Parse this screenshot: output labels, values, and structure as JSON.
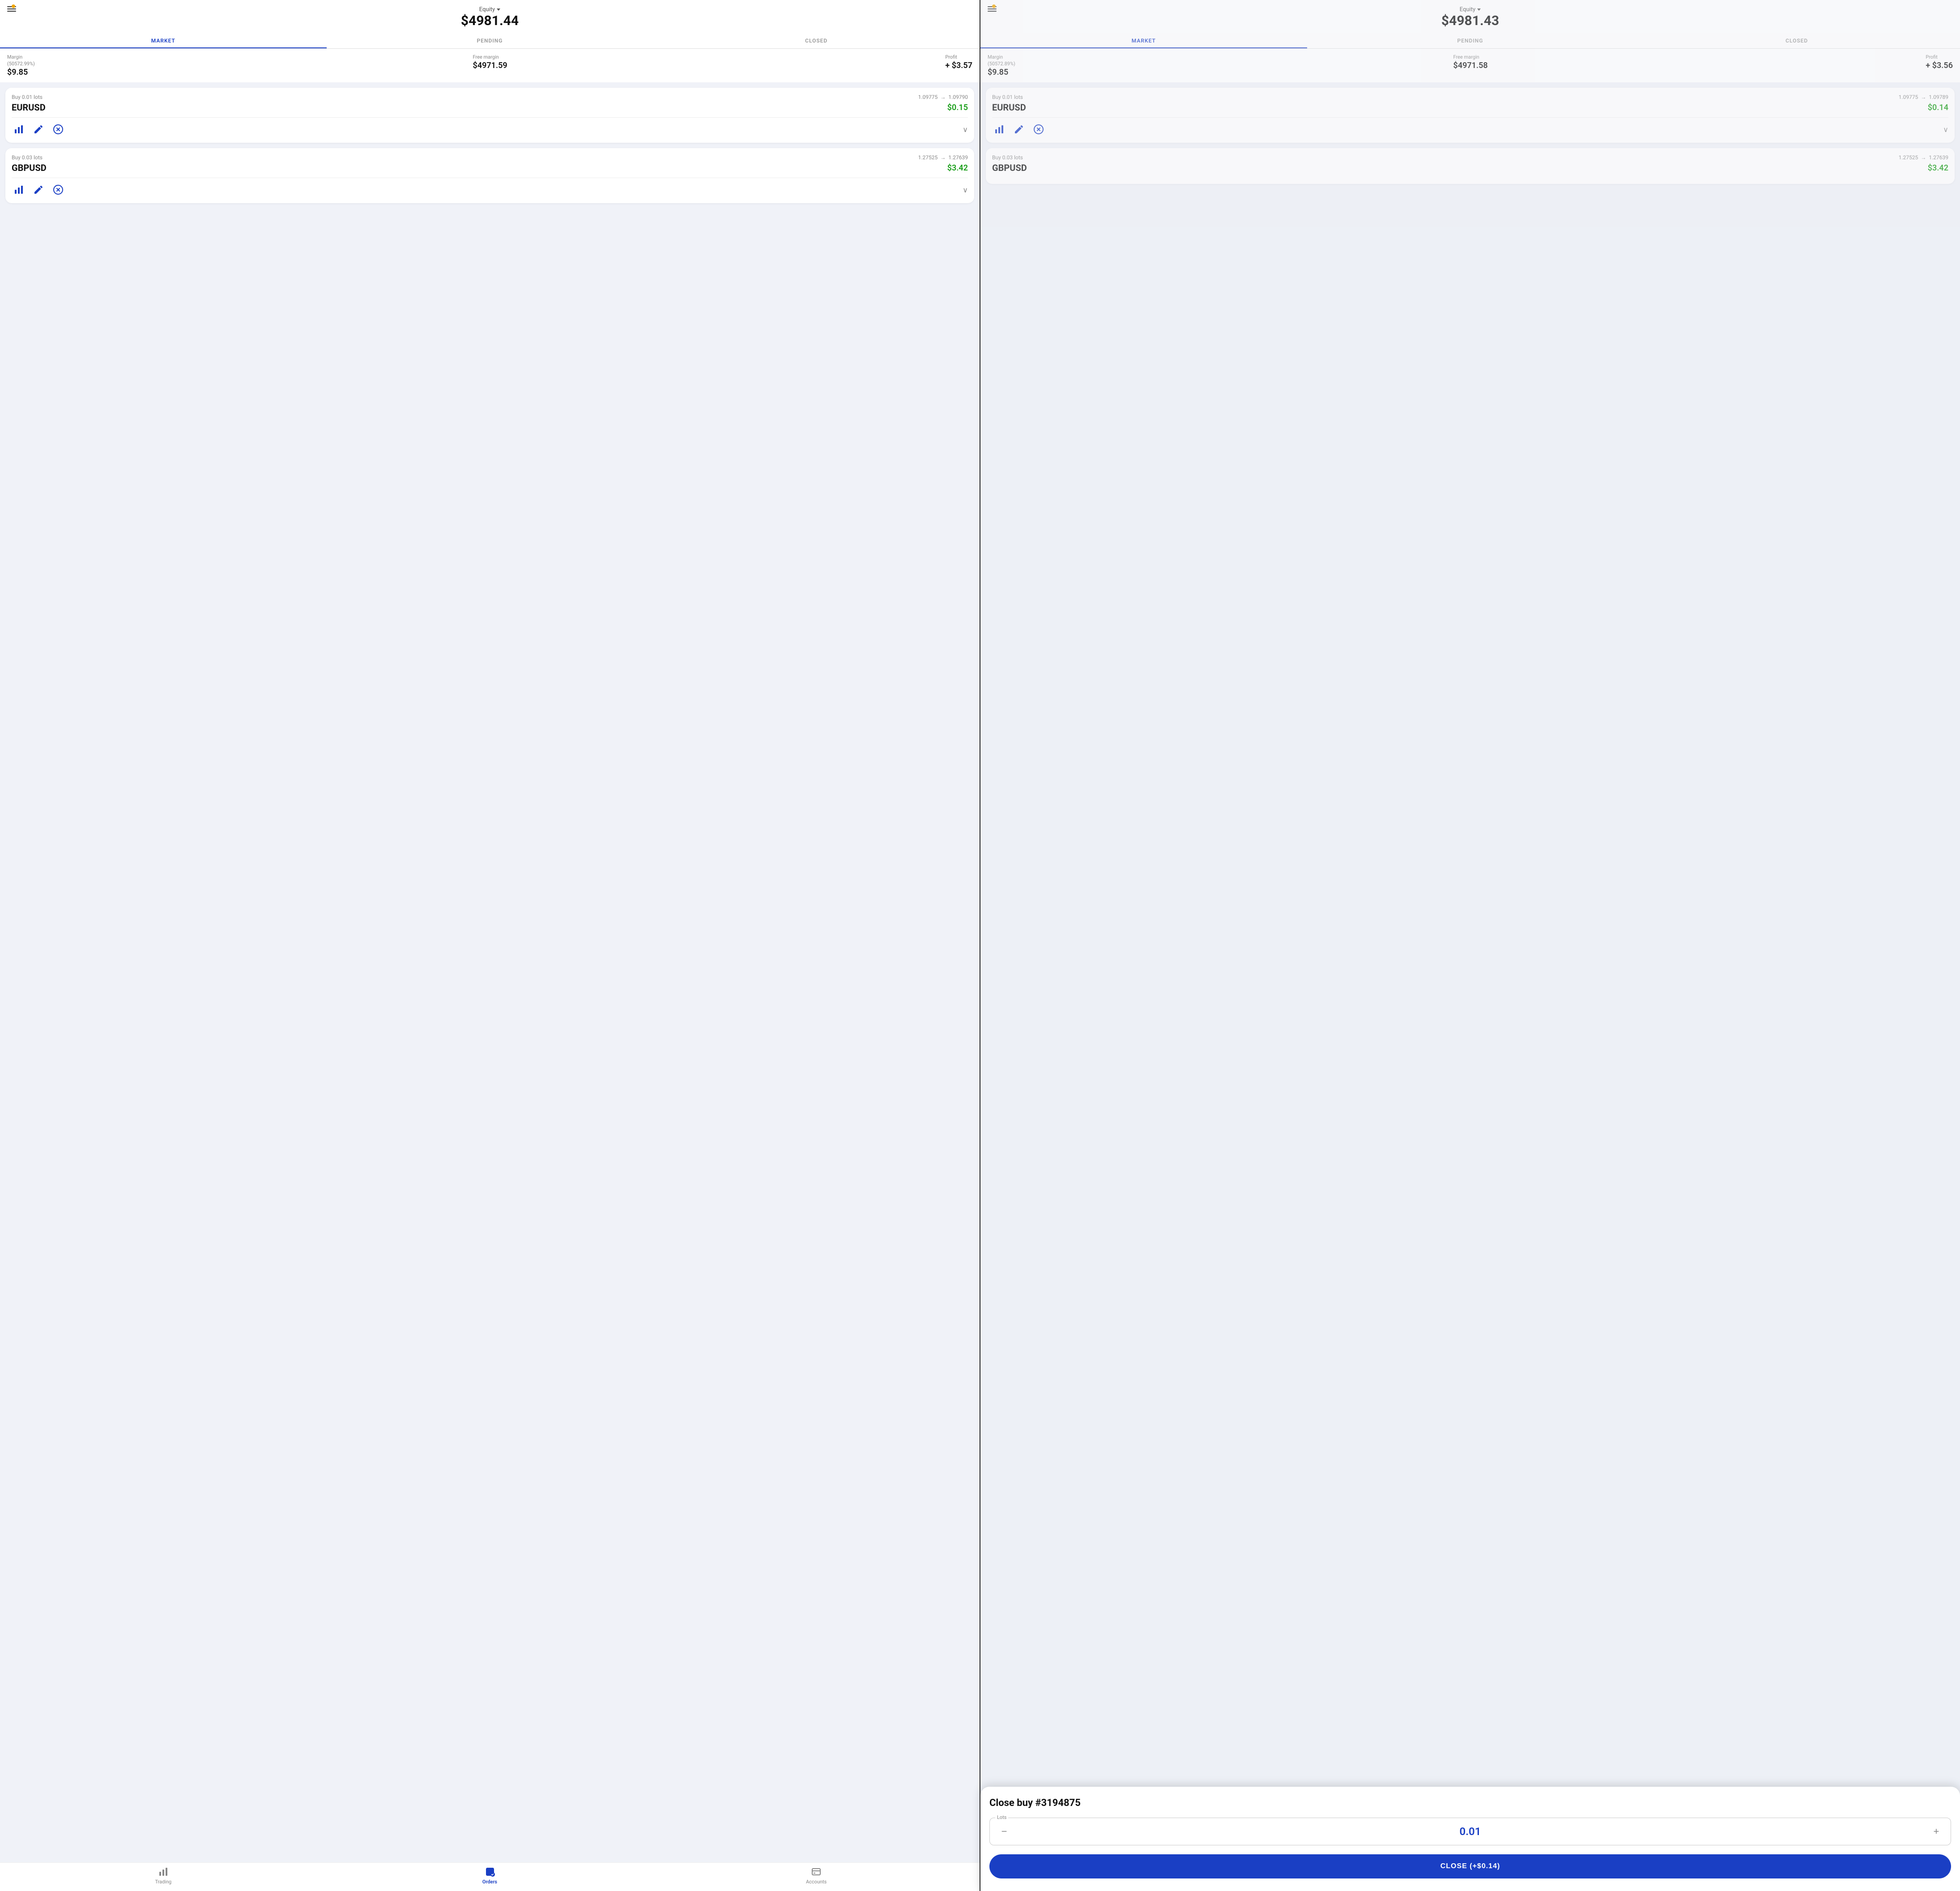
{
  "left": {
    "equity_label": "Equity",
    "equity_amount": "$4981.44",
    "tabs": [
      {
        "id": "market",
        "label": "MARKET",
        "active": true
      },
      {
        "id": "pending",
        "label": "PENDING",
        "active": false
      },
      {
        "id": "closed",
        "label": "CLOSED",
        "active": false
      }
    ],
    "margin": {
      "label": "Margin",
      "sublabel": "(50572.99%)",
      "value": "$9.85",
      "free_margin_label": "Free margin",
      "free_margin_value": "$4971.59",
      "profit_label": "Profit",
      "profit_value": "+ $3.57"
    },
    "orders": [
      {
        "buy_info": "Buy 0.01 lots",
        "price_from": "1.09775",
        "price_to": "1.09790",
        "symbol": "EURUSD",
        "profit": "$0.15"
      },
      {
        "buy_info": "Buy 0.03 lots",
        "price_from": "1.27525",
        "price_to": "1.27639",
        "symbol": "GBPUSD",
        "profit": "$3.42"
      }
    ],
    "nav": {
      "items": [
        {
          "id": "trading",
          "label": "Trading",
          "active": false
        },
        {
          "id": "orders",
          "label": "Orders",
          "active": true
        },
        {
          "id": "accounts",
          "label": "Accounts",
          "active": false
        }
      ]
    }
  },
  "right": {
    "equity_label": "Equity",
    "equity_amount": "$4981.43",
    "tabs": [
      {
        "id": "market",
        "label": "MARKET",
        "active": true
      },
      {
        "id": "pending",
        "label": "PENDING",
        "active": false
      },
      {
        "id": "closed",
        "label": "CLOSED",
        "active": false
      }
    ],
    "margin": {
      "label": "Margin",
      "sublabel": "(50572.89%)",
      "value": "$9.85",
      "free_margin_label": "Free margin",
      "free_margin_value": "$4971.58",
      "profit_label": "Profit",
      "profit_value": "+ $3.56"
    },
    "orders": [
      {
        "buy_info": "Buy 0.01 lots",
        "price_from": "1.09775",
        "price_to": "1.09789",
        "symbol": "EURUSD",
        "profit": "$0.14"
      },
      {
        "buy_info": "Buy 0.03 lots",
        "price_from": "1.27525",
        "price_to": "1.27639",
        "symbol": "GBPUSD",
        "profit": "$3.42"
      }
    ]
  },
  "modal": {
    "title": "Close buy #3194875",
    "lots_label": "Lots",
    "lots_value": "0.01",
    "close_button_label": "CLOSE (+$0.14)"
  }
}
